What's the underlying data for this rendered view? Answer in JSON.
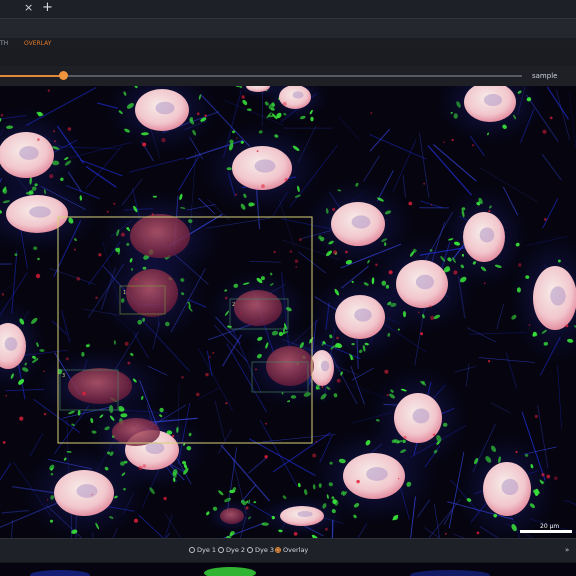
{
  "tabbar": {
    "close_icon": "×",
    "new_tab_icon": "+"
  },
  "modebar": {
    "tab_left": "TH",
    "tab_overlay": "OVERLAY"
  },
  "slider": {
    "label": "sample",
    "position": 0.12,
    "accent": "#e38a3a"
  },
  "viewer": {
    "scale_bar_label": "20 µm",
    "roi_labels": [
      "1",
      "2",
      "3"
    ]
  },
  "channels": {
    "options": [
      {
        "label": "Dye 1",
        "selected": false
      },
      {
        "label": "Dye 2",
        "selected": false
      },
      {
        "label": "Dye 3",
        "selected": false
      },
      {
        "label": "Overlay",
        "selected": true
      }
    ],
    "selected": "Overlay"
  },
  "colors": {
    "nucleus": "#f1c9cf",
    "mitochondria": "#38e03a",
    "actin": "#1f2fe8",
    "roi": "#d8d27a"
  }
}
